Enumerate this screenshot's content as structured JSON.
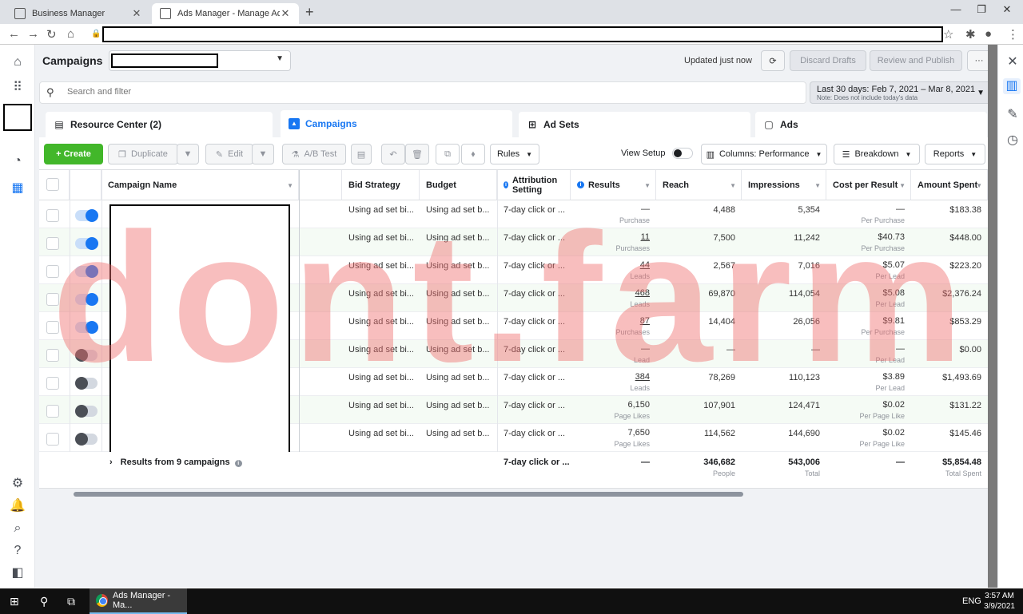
{
  "browser": {
    "tabs": [
      {
        "title": "Business Manager"
      },
      {
        "title": "Ads Manager - Manage Ads - Ca"
      }
    ],
    "new_tab": "+",
    "minimize": "—",
    "restore": "❐",
    "close": "✕"
  },
  "header": {
    "title": "Campaigns",
    "updated": "Updated just now",
    "discard_label": "Discard Drafts",
    "review_label": "Review and Publish",
    "more_label": "···"
  },
  "search": {
    "placeholder": "Search and filter"
  },
  "date_range": {
    "label": "Last 30 days: Feb 7, 2021 – Mar 8, 2021",
    "note": "Note: Does not include today's data"
  },
  "panel_tabs": [
    {
      "label": "Resource Center (2)"
    },
    {
      "label": "Campaigns"
    },
    {
      "label": "Ad Sets"
    },
    {
      "label": "Ads"
    }
  ],
  "toolbar": {
    "create": "+ Create",
    "duplicate": "Duplicate",
    "edit": "Edit",
    "ab_test": "A/B Test",
    "rules": "Rules",
    "view_setup": "View Setup",
    "columns": "Columns: Performance",
    "breakdown": "Breakdown",
    "reports": "Reports"
  },
  "columns": {
    "campaign_name": "Campaign Name",
    "bid_strategy": "Bid Strategy",
    "budget": "Budget",
    "attribution": "Attribution Setting",
    "results": "Results",
    "reach": "Reach",
    "impressions": "Impressions",
    "cost_per_result": "Cost per Result",
    "amount_spent": "Amount Spent"
  },
  "rows": [
    {
      "on": true,
      "bid": "Using ad set bi...",
      "budget": "Using ad set b...",
      "attr": "7-day click or ...",
      "results": "—",
      "results_sub": "Purchase",
      "reach": "4,488",
      "impressions": "5,354",
      "cpr": "—",
      "cpr_sub": "Per Purchase",
      "spent": "$183.38"
    },
    {
      "on": true,
      "bid": "Using ad set bi...",
      "budget": "Using ad set b...",
      "attr": "7-day click or ...",
      "results": "11",
      "results_sub": "Purchases",
      "reach": "7,500",
      "impressions": "11,242",
      "cpr": "$40.73",
      "cpr_sub": "Per Purchase",
      "spent": "$448.00"
    },
    {
      "on": true,
      "bid": "Using ad set bi...",
      "budget": "Using ad set b...",
      "attr": "7-day click or ...",
      "results": "44",
      "results_sub": "Leads",
      "reach": "2,567",
      "impressions": "7,016",
      "cpr": "$5.07",
      "cpr_sub": "Per Lead",
      "spent": "$223.20"
    },
    {
      "on": true,
      "bid": "Using ad set bi...",
      "budget": "Using ad set b...",
      "attr": "7-day click or ...",
      "results": "468",
      "results_sub": "Leads",
      "reach": "69,870",
      "impressions": "114,054",
      "cpr": "$5.08",
      "cpr_sub": "Per Lead",
      "spent": "$2,376.24"
    },
    {
      "on": true,
      "bid": "Using ad set bi...",
      "budget": "Using ad set b...",
      "attr": "7-day click or ...",
      "results": "87",
      "results_sub": "Purchases",
      "reach": "14,404",
      "impressions": "26,056",
      "cpr": "$9.81",
      "cpr_sub": "Per Purchase",
      "spent": "$853.29"
    },
    {
      "on": false,
      "bid": "Using ad set bi...",
      "budget": "Using ad set b...",
      "attr": "7-day click or ...",
      "results": "—",
      "results_sub": "Lead",
      "reach": "—",
      "impressions": "—",
      "cpr": "—",
      "cpr_sub": "Per Lead",
      "spent": "$0.00"
    },
    {
      "on": false,
      "bid": "Using ad set bi...",
      "budget": "Using ad set b...",
      "attr": "7-day click or ...",
      "results": "384",
      "results_sub": "Leads",
      "reach": "78,269",
      "impressions": "110,123",
      "cpr": "$3.89",
      "cpr_sub": "Per Lead",
      "spent": "$1,493.69"
    },
    {
      "on": false,
      "bid": "Using ad set bi...",
      "budget": "Using ad set b...",
      "attr": "7-day click or ...",
      "results": "6,150",
      "results_sub": "Page Likes",
      "reach": "107,901",
      "impressions": "124,471",
      "cpr": "$0.02",
      "cpr_sub": "Per Page Like",
      "spent": "$131.22"
    },
    {
      "on": false,
      "bid": "Using ad set bi...",
      "budget": "Using ad set b...",
      "attr": "7-day click or ...",
      "results": "7,650",
      "results_sub": "Page Likes",
      "reach": "114,562",
      "impressions": "144,690",
      "cpr": "$0.02",
      "cpr_sub": "Per Page Like",
      "spent": "$145.46"
    }
  ],
  "totals": {
    "label": "Results from 9 campaigns",
    "attr": "7-day click or ...",
    "results": "—",
    "reach": "346,682",
    "reach_sub": "People",
    "impressions": "543,006",
    "impressions_sub": "Total",
    "cpr": "—",
    "spent": "$5,854.48",
    "spent_sub": "Total Spent"
  },
  "watermark": "dont.farm",
  "taskbar": {
    "app": "Ads Manager - Ma...",
    "lang": "ENG",
    "time": "3:57 AM",
    "date": "3/9/2021"
  }
}
